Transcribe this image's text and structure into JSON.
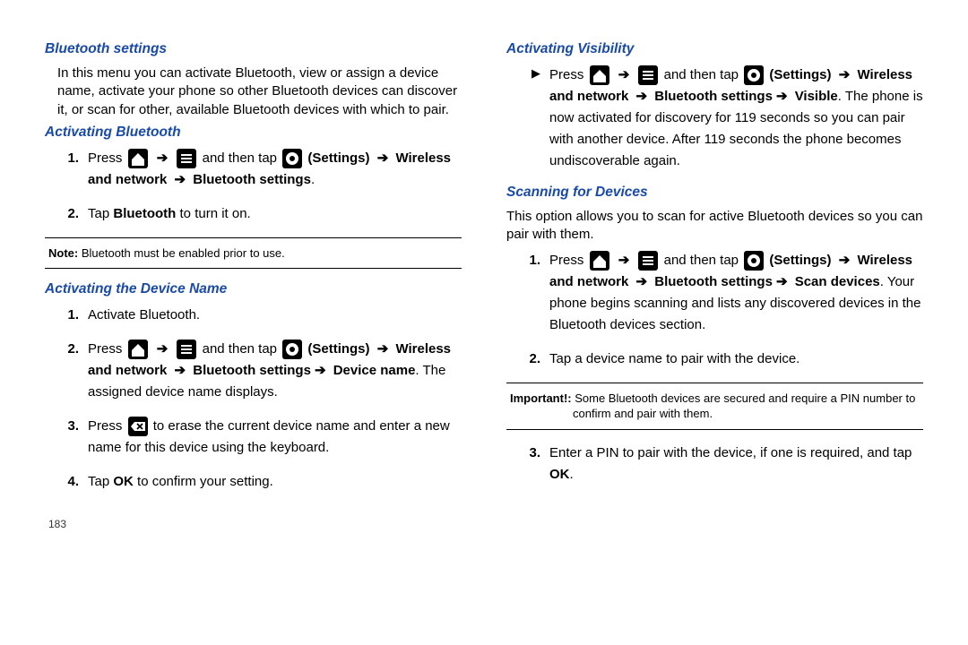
{
  "left": {
    "h_bt": "Bluetooth settings",
    "p_bt": "In this menu you can activate Bluetooth, view or assign a device name, activate your phone so other Bluetooth devices can discover it, or scan for other, available Bluetooth devices with which to pair.",
    "h_act": "Activating Bluetooth",
    "s1_press": "Press ",
    "s1_andtap": " and then tap ",
    "s1_settings": " (Settings) ",
    "s1_path1": "Wireless and network ",
    "s1_path2": " Bluetooth settings",
    "s2a": "Tap ",
    "s2b": "Bluetooth",
    "s2c": " to turn it on.",
    "note_lead": "Note:",
    "note_body": " Bluetooth must be enabled prior to use.",
    "h_dev": "Activating the Device Name",
    "d1": "Activate Bluetooth.",
    "d2_path": " Device name",
    "d2_tail": ". The assigned device name displays.",
    "d3a": "Press ",
    "d3b": " to erase the current device name and enter a new name for this device using the keyboard.",
    "d4a": "Tap ",
    "d4b": "OK",
    "d4c": " to confirm your setting.",
    "pagenum": "183"
  },
  "right": {
    "h_vis": "Activating Visibility",
    "v_path": " Visible",
    "v_tail": ". The phone is now activated for discovery for 119 seconds so you can pair with another device. After 119 seconds the phone becomes undiscoverable again.",
    "h_scan": "Scanning for Devices",
    "p_scan": "This option allows you to scan for active Bluetooth devices so you can pair with them.",
    "sc1_path": " Scan devices",
    "sc1_tail": ". Your phone begins scanning and lists any discovered devices in the Bluetooth devices section.",
    "sc2": "Tap a device name to pair with the device.",
    "imp_lead": "Important!:",
    "imp_body": " Some Bluetooth devices are secured and require a PIN number to confirm and pair with them.",
    "sc3a": "Enter a PIN to pair with the device, if one is required, and tap ",
    "sc3b": "OK",
    "sc3c": "."
  },
  "arrow": "➔"
}
